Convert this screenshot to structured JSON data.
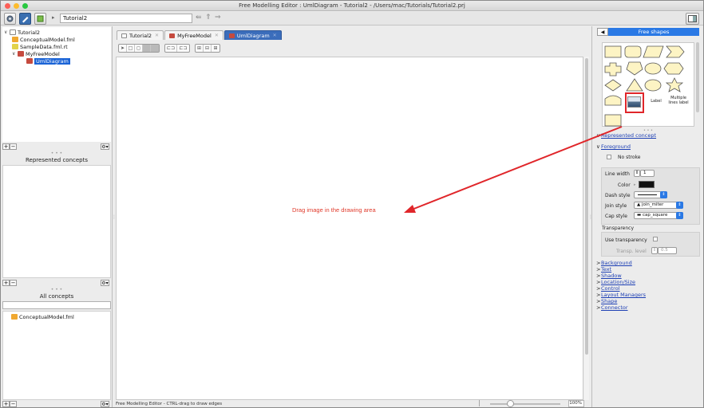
{
  "window": {
    "title": "Free Modelling Editor : UmlDiagram - Tutorial2 - /Users/mac/Tutorials/Tutorial2.prj"
  },
  "toolbar": {
    "breadcrumb": "Tutorial2"
  },
  "project_tree": {
    "items": [
      {
        "label": "Tutorial2",
        "level": 0,
        "icon": "project-icon"
      },
      {
        "label": "ConceptualModel.fml",
        "level": 1,
        "icon": "fml-icon"
      },
      {
        "label": "SampleData.fml.rt",
        "level": 1,
        "icon": "runtime-icon"
      },
      {
        "label": "MyFreeModel",
        "level": 1,
        "icon": "free-model-icon"
      },
      {
        "label": "UmlDiagram",
        "level": 2,
        "icon": "diagram-icon",
        "selected": true
      }
    ]
  },
  "represented_concepts": {
    "title": "Represented concepts"
  },
  "all_concepts": {
    "title": "All concepts",
    "search_value": "",
    "items": [
      "ConceptualModel.fml"
    ]
  },
  "tabs": [
    {
      "label": "Tutorial2",
      "active": false
    },
    {
      "label": "MyFreeModel",
      "active": false
    },
    {
      "label": "UmlDiagram",
      "active": true
    }
  ],
  "canvas": {
    "annotation": "Drag image in the drawing area",
    "annotation_color": "#e03b2c"
  },
  "status": {
    "text": "Free Modelling Editor - CTRL-drag to draw edges",
    "zoom": "100%"
  },
  "palette": {
    "title": "Free shapes",
    "label_item": "Label",
    "multiline_item": "Multiple lines label",
    "selected_item": "image-icon",
    "highlight_color": "#e0262a"
  },
  "inspector": {
    "represented_concept": "Represented concept",
    "foreground": "Foreground",
    "no_stroke": "No stroke",
    "line_width_label": "Line width",
    "line_width_value": "1",
    "color_label": "Color",
    "dash_style_label": "Dash style",
    "join_style_label": "Join style",
    "join_style_value": "join_miter",
    "cap_style_label": "Cap style",
    "cap_style_value": "cap_square",
    "transparency": "Transparency",
    "use_transparency": "Use transparency",
    "transp_level_label": "Transp. level",
    "transp_level_value": "0.5",
    "sections": [
      "Background",
      "Text",
      "Shadow",
      "Location/Size",
      "Control",
      "Layout Managers",
      "Shape",
      "Connector"
    ]
  }
}
